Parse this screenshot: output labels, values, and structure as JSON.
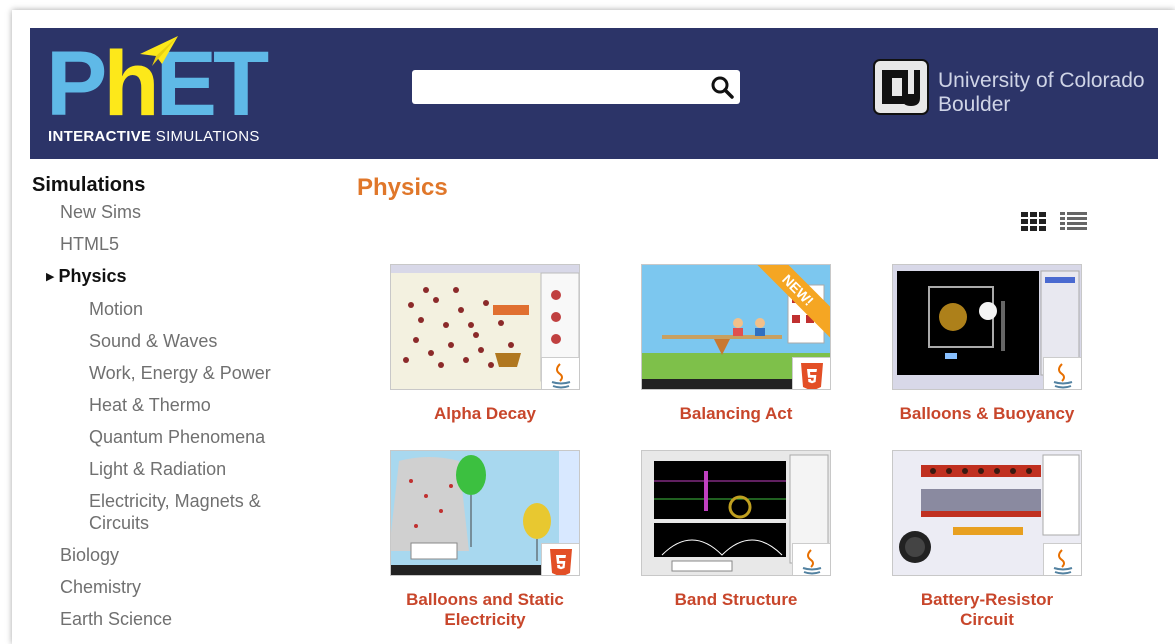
{
  "header": {
    "logo": {
      "letters": [
        "P",
        "h",
        "E",
        "T"
      ],
      "sub_bold": "INTERACTIVE",
      "sub_regular": "SIMULATIONS"
    },
    "search": {
      "placeholder": "",
      "value": "",
      "icon": "search-icon"
    },
    "university": {
      "line1": "University of Colorado",
      "line2": "Boulder"
    }
  },
  "sidebar": {
    "title": "Simulations",
    "items": [
      {
        "label": "New Sims",
        "level": 1
      },
      {
        "label": "HTML5",
        "level": 1
      },
      {
        "label": "Physics",
        "level": 1,
        "active": true
      },
      {
        "label": "Motion",
        "level": 2
      },
      {
        "label": "Sound & Waves",
        "level": 2
      },
      {
        "label": "Work, Energy & Power",
        "level": 2
      },
      {
        "label": "Heat & Thermo",
        "level": 2
      },
      {
        "label": "Quantum Phenomena",
        "level": 2
      },
      {
        "label": "Light & Radiation",
        "level": 2
      },
      {
        "label": "Electricity, Magnets &",
        "label2": "Circuits",
        "level": 2
      },
      {
        "label": "Biology",
        "level": 1
      },
      {
        "label": "Chemistry",
        "level": 1
      },
      {
        "label": "Earth Science",
        "level": 1
      }
    ]
  },
  "main": {
    "title": "Physics",
    "view_icons": [
      "grid-view-icon",
      "list-view-icon"
    ],
    "sims": [
      {
        "title": "Alpha Decay",
        "badge": "java"
      },
      {
        "title": "Balancing Act",
        "badge": "html5",
        "ribbon": "NEW!"
      },
      {
        "title": "Balloons & Buoyancy",
        "badge": "java"
      },
      {
        "title": "Balloons and Static",
        "title2": "Electricity",
        "badge": "html5"
      },
      {
        "title": "Band Structure",
        "badge": "java"
      },
      {
        "title": "Battery-Resistor",
        "title2": "Circuit",
        "badge": "java"
      }
    ]
  },
  "colors": {
    "header_bg": "#2c3468",
    "phet_blue": "#5fb9e7",
    "phet_yellow": "#fde81a",
    "section_title": "#e0772a",
    "sim_title": "#c8462b",
    "html5_badge": "#e34f26"
  }
}
